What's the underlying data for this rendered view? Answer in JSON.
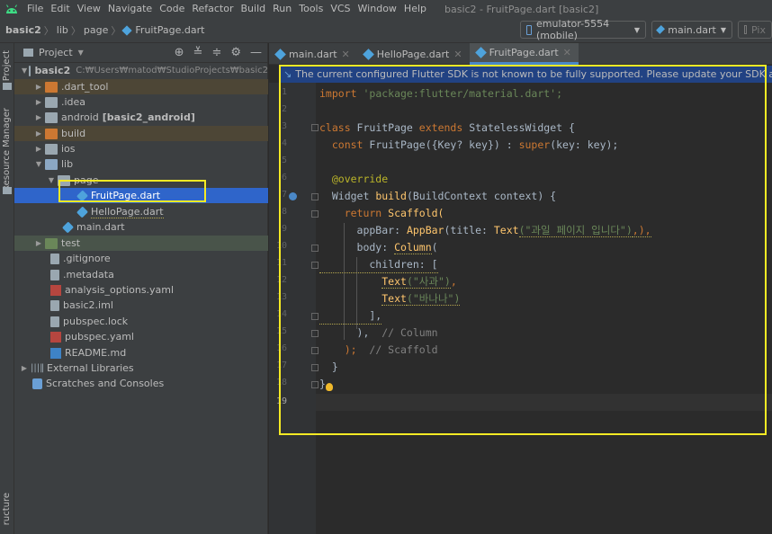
{
  "menu": [
    "File",
    "Edit",
    "View",
    "Navigate",
    "Code",
    "Refactor",
    "Build",
    "Run",
    "Tools",
    "VCS",
    "Window",
    "Help"
  ],
  "window_title": "basic2 - FruitPage.dart [basic2]",
  "breadcrumb": [
    "basic2",
    "lib",
    "page",
    "FruitPage.dart"
  ],
  "device_selector": "emulator-5554 (mobile)",
  "run_config": "main.dart",
  "pixel_btn": "Pix",
  "strip": {
    "project": "Project",
    "resource_manager": "Resource Manager",
    "structure": "ructure"
  },
  "project_panel": {
    "title": "Project",
    "root_name": "basic2",
    "root_path": "C:₩Users₩matod₩StudioProjects₩basic2",
    "android_module": "[basic2_android]",
    "items": [
      ".dart_tool",
      ".idea",
      "android",
      "build",
      "ios",
      "lib",
      "page",
      "FruitPage.dart",
      "HelloPage.dart",
      "main.dart",
      "test",
      ".gitignore",
      ".metadata",
      "analysis_options.yaml",
      "basic2.iml",
      "pubspec.lock",
      "pubspec.yaml",
      "README.md",
      "External Libraries",
      "Scratches and Consoles"
    ]
  },
  "tabs": [
    "main.dart",
    "HelloPage.dart",
    "FruitPage.dart"
  ],
  "banner": "The current configured Flutter SDK is not known to be fully supported. Please update your SDK and restart IntelliJ",
  "line_numbers": [
    "1",
    "2",
    "3",
    "4",
    "5",
    "6",
    "7",
    "8",
    "9",
    "10",
    "11",
    "12",
    "13",
    "14",
    "15",
    "16",
    "17",
    "18",
    "19"
  ],
  "code": {
    "l1a": "import",
    "l1b": " 'package:flutter/material.dart';",
    "l3a": "class",
    "l3b": " FruitPage ",
    "l3c": "extends",
    "l3d": " StatelessWidget {",
    "l4a": "  const",
    "l4b": " FruitPage({Key? key}) : ",
    "l4c": "super",
    "l4d": "(key: key);",
    "l6": "  @override",
    "l7a": "  Widget ",
    "l7b": "build",
    "l7c": "(BuildContext context) {",
    "l8a": "    return",
    "l8b": " Scaffold(",
    "l9a": "      appBar: ",
    "l9b": "AppBar",
    "l9c": "(title: ",
    "l9d": "Text",
    "l9e": "(\"과일 페이지 입니다\")",
    "l9f": ",),",
    "l10a": "      body: ",
    "l10b": "Column",
    "l10c": "(",
    "l11": "        children: [",
    "l12a": "          ",
    "l12b": "Text",
    "l12c": "(\"사과\")",
    "l12d": ",",
    "l13a": "          ",
    "l13b": "Text",
    "l13c": "(\"바나나\")",
    "l14": "        ],",
    "l15a": "      ),",
    "l15b": "  // Column",
    "l16a": "    );",
    "l16b": "  // Scaffold",
    "l17": "  }",
    "l18": "}"
  }
}
